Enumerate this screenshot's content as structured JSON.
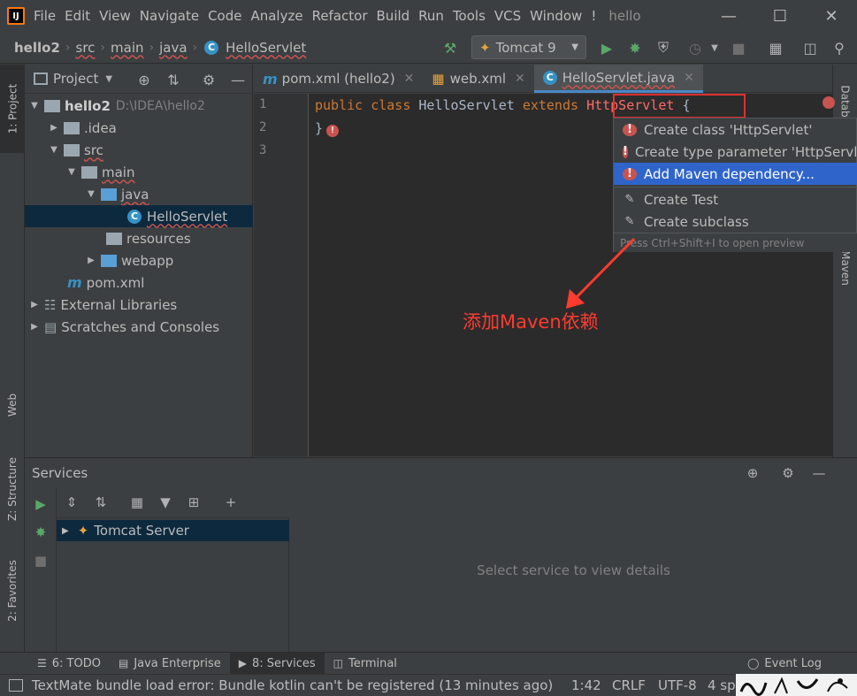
{
  "app": {
    "logo_text": "IJ",
    "menu": [
      "File",
      "Edit",
      "View",
      "Navigate",
      "Code",
      "Analyze",
      "Refactor",
      "Build",
      "Run",
      "Tools",
      "VCS",
      "Window"
    ],
    "menu_overflow": "!",
    "window_title": "hello",
    "window_controls": [
      "minimize",
      "maximize",
      "close"
    ]
  },
  "navbar": {
    "breadcrumbs": [
      "hello2",
      "src",
      "main",
      "java",
      "HelloServlet"
    ],
    "run_config": "Tomcat 9"
  },
  "left_stripe": {
    "tabs": [
      "1: Project",
      "Web",
      "Z: Structure",
      "2: Favorites"
    ]
  },
  "project_panel": {
    "title": "Project",
    "tree": [
      {
        "label": "hello2",
        "hint": "D:\\IDEA\\hello2",
        "depth": 0,
        "expanded": true,
        "icon": "folder-icon"
      },
      {
        "label": ".idea",
        "depth": 1,
        "expanded": false,
        "icon": "folder-icon"
      },
      {
        "label": "src",
        "depth": 1,
        "expanded": true,
        "icon": "folder-icon"
      },
      {
        "label": "main",
        "depth": 2,
        "expanded": true,
        "icon": "folder-icon"
      },
      {
        "label": "java",
        "depth": 3,
        "expanded": true,
        "icon": "source-folder-icon"
      },
      {
        "label": "HelloServlet",
        "depth": 4,
        "icon": "class-icon",
        "selected": true
      },
      {
        "label": "resources",
        "depth": 3,
        "icon": "resources-folder-icon"
      },
      {
        "label": "webapp",
        "depth": 3,
        "expanded": false,
        "icon": "web-folder-icon"
      },
      {
        "label": "pom.xml",
        "depth": 2,
        "icon": "maven-icon"
      },
      {
        "label": "External Libraries",
        "depth": 0,
        "expanded": false,
        "icon": "libraries-icon"
      },
      {
        "label": "Scratches and Consoles",
        "depth": 0,
        "expanded": false,
        "icon": "scratches-icon"
      }
    ]
  },
  "editor": {
    "tabs": [
      {
        "label": "pom.xml (hello2)",
        "icon": "maven-icon",
        "active": false
      },
      {
        "label": "web.xml",
        "icon": "xml-icon",
        "active": false
      },
      {
        "label": "HelloServlet.java",
        "icon": "class-icon",
        "active": true
      }
    ],
    "line_numbers": [
      "1",
      "2",
      "3"
    ],
    "code": {
      "kw_public": "public",
      "kw_class": "class",
      "class_name": "HelloServlet",
      "kw_extends": "extends",
      "error_type": "HttpServlet",
      "brace_open": "{",
      "brace_close": "}"
    }
  },
  "right_stripe": {
    "tabs": [
      "Database",
      "Maven"
    ]
  },
  "intention_popup": {
    "items": [
      {
        "label": "Create class 'HttpServlet'",
        "icon": "error-bulb-icon"
      },
      {
        "label": "Create type parameter 'HttpServlet'",
        "icon": "error-bulb-icon"
      },
      {
        "label": "Add Maven dependency...",
        "icon": "error-bulb-icon",
        "selected": true
      },
      {
        "label": "Create Test",
        "icon": "edit-icon"
      },
      {
        "label": "Create subclass",
        "icon": "edit-icon"
      }
    ],
    "hint": "Press Ctrl+Shift+I to open preview"
  },
  "annotation": {
    "text": "添加Maven依赖"
  },
  "services": {
    "title": "Services",
    "tree_item": "Tomcat Server",
    "empty_text": "Select service to view details"
  },
  "tool_windows": [
    {
      "label": "6: TODO",
      "icon": "todo-icon"
    },
    {
      "label": "Java Enterprise",
      "icon": "java-enterprise-icon"
    },
    {
      "label": "8: Services",
      "icon": "services-icon",
      "active": true
    },
    {
      "label": "Terminal",
      "icon": "terminal-icon"
    },
    {
      "label": "Event Log",
      "icon": "event-log-icon"
    }
  ],
  "statusbar": {
    "message": "TextMate bundle load error: Bundle kotlin can't be registered (13 minutes ago)",
    "position": "1:42",
    "line_sep": "CRLF",
    "encoding": "UTF-8",
    "indent": "4 sp"
  },
  "colors": {
    "background": "#3c3f41",
    "editor_bg": "#2b2b2b",
    "keyword": "#cc7832",
    "error": "#ff6b68",
    "selection": "#2f65ca",
    "annotation": "#ff3b30"
  }
}
